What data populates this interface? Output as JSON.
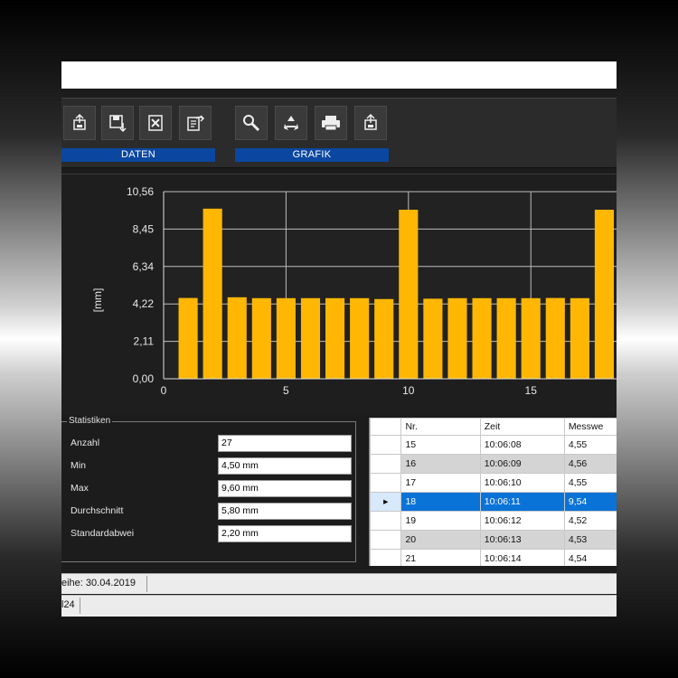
{
  "toolbar": {
    "groups": [
      {
        "label": "DATEN"
      },
      {
        "label": "GRAFIK"
      }
    ],
    "buttons": [
      {
        "icon": "import-icon"
      },
      {
        "icon": "save-icon"
      },
      {
        "icon": "excel-export-icon"
      },
      {
        "icon": "export-icon"
      },
      {
        "icon": "zoom-icon"
      },
      {
        "icon": "recycle-icon"
      },
      {
        "icon": "print-icon"
      },
      {
        "icon": "import-icon"
      }
    ]
  },
  "chart_data": {
    "type": "bar",
    "ylabel": "[mm]",
    "ylim": [
      0,
      10.56
    ],
    "xlim": [
      0,
      18.5
    ],
    "yticks": [
      "0,00",
      "2,11",
      "4,22",
      "6,34",
      "8,45",
      "10,56"
    ],
    "xticks": [
      "0",
      "5",
      "10",
      "15"
    ],
    "bar_color": "#ffb703",
    "x": [
      1,
      2,
      3,
      4,
      5,
      6,
      7,
      8,
      9,
      10,
      11,
      12,
      13,
      14,
      15,
      16,
      17,
      18
    ],
    "values": [
      4.56,
      9.6,
      4.6,
      4.55,
      4.55,
      4.55,
      4.55,
      4.55,
      4.5,
      9.54,
      4.52,
      4.55,
      4.55,
      4.55,
      4.55,
      4.56,
      4.55,
      9.54
    ]
  },
  "stats": {
    "legend": "Statistiken",
    "rows": [
      {
        "label": "Anzahl",
        "value": "27"
      },
      {
        "label": "Min",
        "value": "4,50 mm"
      },
      {
        "label": "Max",
        "value": "9,60 mm"
      },
      {
        "label": "Durchschnitt",
        "value": "5,80 mm"
      },
      {
        "label": "Standardabwei",
        "value": "2,20 mm"
      }
    ]
  },
  "table": {
    "headers": [
      "Nr.",
      "Zeit",
      "Messwe"
    ],
    "rows": [
      [
        "15",
        "10:06:08",
        "4,55"
      ],
      [
        "16",
        "10:06:09",
        "4,56"
      ],
      [
        "17",
        "10:06:10",
        "4,55"
      ],
      [
        "18",
        "10:06:11",
        "9,54"
      ],
      [
        "19",
        "10:06:12",
        "4,52"
      ],
      [
        "20",
        "10:06:13",
        "4,53"
      ],
      [
        "21",
        "10:06:14",
        "4,54"
      ]
    ],
    "selected_index": 3,
    "selected_marker": "▸"
  },
  "status": {
    "line1": "eihe: 30.04.2019",
    "line2": "l24"
  },
  "colors": {
    "accent": "#0b47a1",
    "selection": "#0a73d8",
    "bar": "#ffb703"
  }
}
